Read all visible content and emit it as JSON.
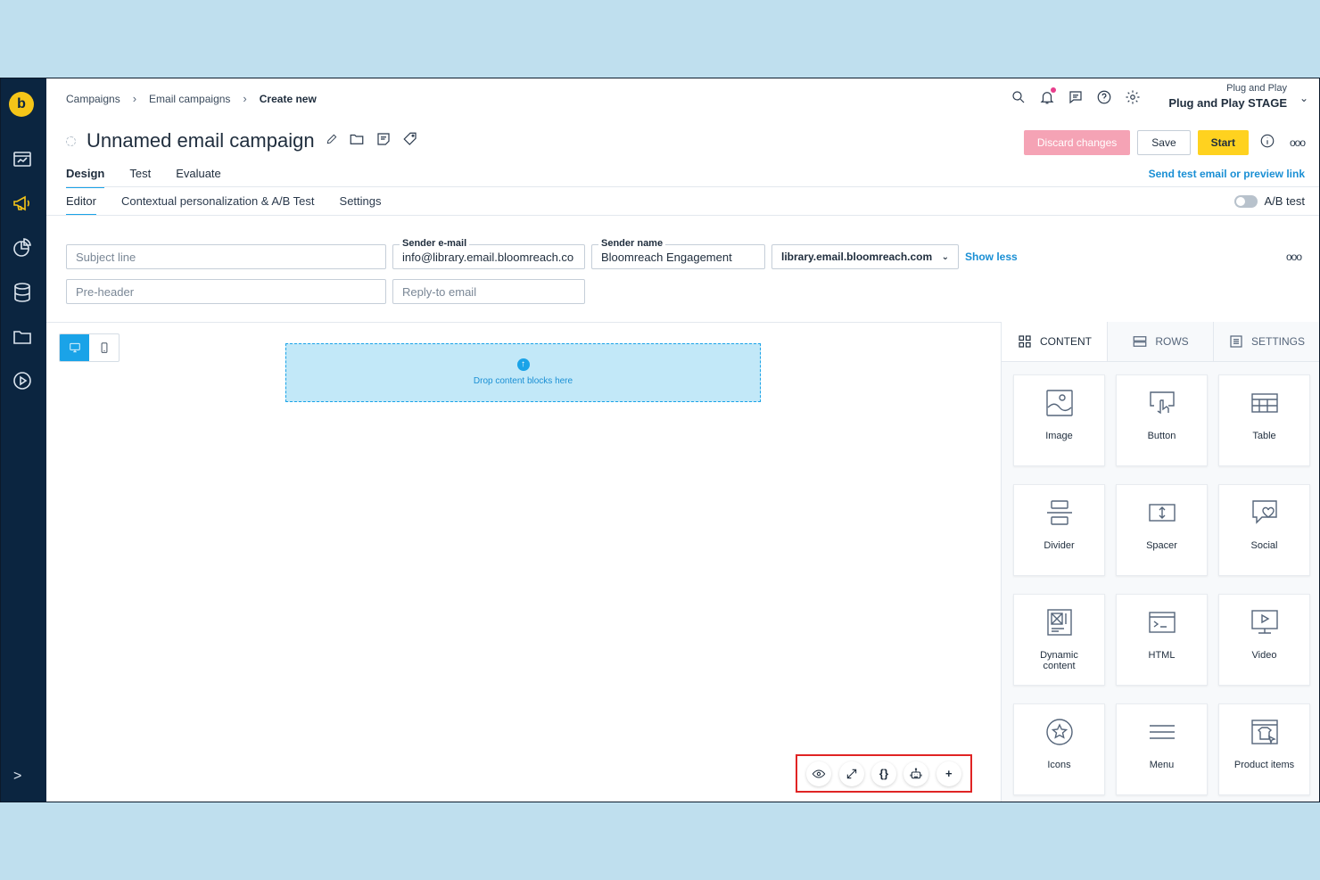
{
  "sidebar": {
    "logo": "b",
    "items": [
      "dashboard-icon",
      "megaphone-icon",
      "analytics-icon",
      "database-icon",
      "folder-icon",
      "play-icon"
    ],
    "expand": ">"
  },
  "breadcrumb": {
    "items": [
      "Campaigns",
      "Email campaigns",
      "Create new"
    ],
    "separator": "›"
  },
  "account": {
    "org": "Plug and Play",
    "project": "Plug and Play STAGE"
  },
  "campaign": {
    "title": "Unnamed email campaign"
  },
  "actions": {
    "discard": "Discard changes",
    "save": "Save",
    "start": "Start",
    "more": "ooo"
  },
  "tabs_main": [
    "Design",
    "Test",
    "Evaluate"
  ],
  "send_test_link": "Send test email or preview link",
  "tabs_sub": [
    "Editor",
    "Contextual personalization & A/B Test",
    "Settings"
  ],
  "ab_test_label": "A/B test",
  "form": {
    "subject_placeholder": "Subject line",
    "preheader_placeholder": "Pre-header",
    "sender_email_label": "Sender e-mail",
    "sender_email_value": "info@library.email.bloomreach.co",
    "reply_to_placeholder": "Reply-to email",
    "sender_name_label": "Sender name",
    "sender_name_value": "Bloomreach Engagement",
    "domain": "library.email.bloomreach.com",
    "show_less": "Show less",
    "more": "ooo"
  },
  "canvas": {
    "dropzone_text": "Drop content blocks here"
  },
  "bottom_tools": [
    "eye-icon",
    "expand-icon",
    "{}",
    "robot-icon",
    "+"
  ],
  "panel": {
    "tabs": [
      "CONTENT",
      "ROWS",
      "SETTINGS"
    ],
    "blocks": [
      "Image",
      "Button",
      "Table",
      "Divider",
      "Spacer",
      "Social",
      "Dynamic content",
      "HTML",
      "Video",
      "Icons",
      "Menu",
      "Product items"
    ]
  },
  "colors": {
    "sidebar_bg": "#0b2540",
    "accent_blue": "#1aa3e8",
    "start_yellow": "#ffd21f",
    "discard_pink": "#f5a3b5",
    "highlight_red": "#e02424"
  }
}
